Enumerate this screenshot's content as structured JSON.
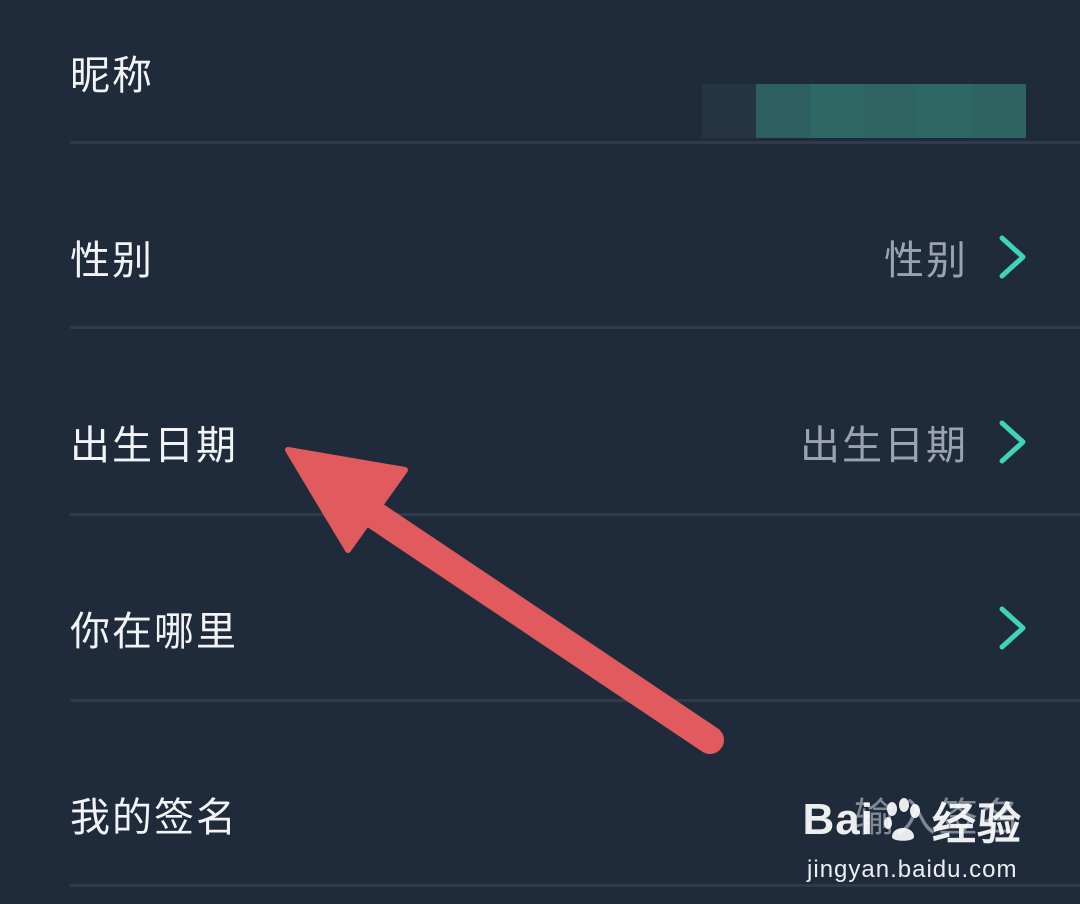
{
  "profile": {
    "rows": [
      {
        "label": "昵称",
        "value": "",
        "has_chevron": false
      },
      {
        "label": "性别",
        "value": "性别",
        "has_chevron": true
      },
      {
        "label": "出生日期",
        "value": "出生日期",
        "has_chevron": true
      },
      {
        "label": "你在哪里",
        "value": "",
        "has_chevron": true
      },
      {
        "label": "我的签名",
        "value": "输入签名",
        "has_chevron": false
      }
    ]
  },
  "watermark": {
    "brand_left": "Bai",
    "brand_right": "经验",
    "url": "jingyan.baidu.com"
  },
  "colors": {
    "background": "#1f2a3a",
    "label_text": "#f1f3f5",
    "value_text": "#9aa4b1",
    "chevron": "#3fd3b8",
    "divider": "#2f3b4c",
    "annotation_arrow": "#e05a5e"
  },
  "icons": {
    "chevron": "chevron-right-icon",
    "arrow": "annotation-arrow-icon"
  }
}
